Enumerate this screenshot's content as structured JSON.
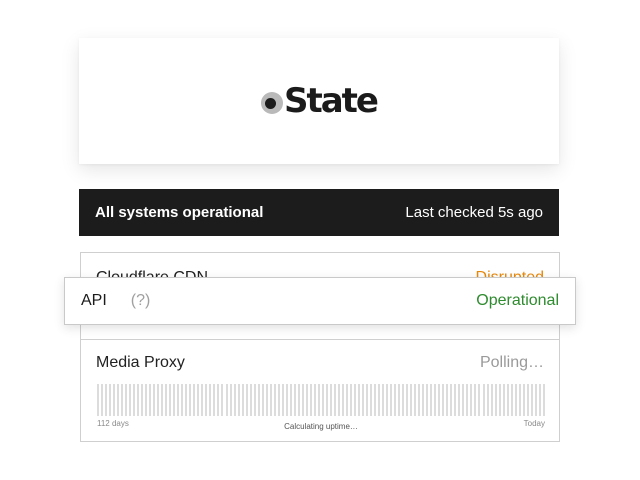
{
  "brand": {
    "name": "State"
  },
  "banner": {
    "summary": "All systems operational",
    "last_checked": "Last checked 5s ago"
  },
  "components": [
    {
      "name": "Cloudflare CDN",
      "status": "Disrupted",
      "status_color": "#e8890c"
    },
    {
      "name": "API",
      "help": "(?)",
      "status": "Operational",
      "status_color": "#2e8b2e"
    },
    {
      "name": "Media Proxy",
      "status": "Polling…",
      "status_color": "#9a9a9a"
    }
  ],
  "uptime": {
    "start_label": "112 days",
    "center_label": "Calculating uptime…",
    "end_label": "Today"
  },
  "colors": {
    "banner_bg": "#1c1c1c",
    "operational": "#2e8b2e",
    "disrupted": "#e8890c",
    "polling": "#9a9a9a"
  },
  "icons": {
    "logo": "state-logo-icon"
  }
}
